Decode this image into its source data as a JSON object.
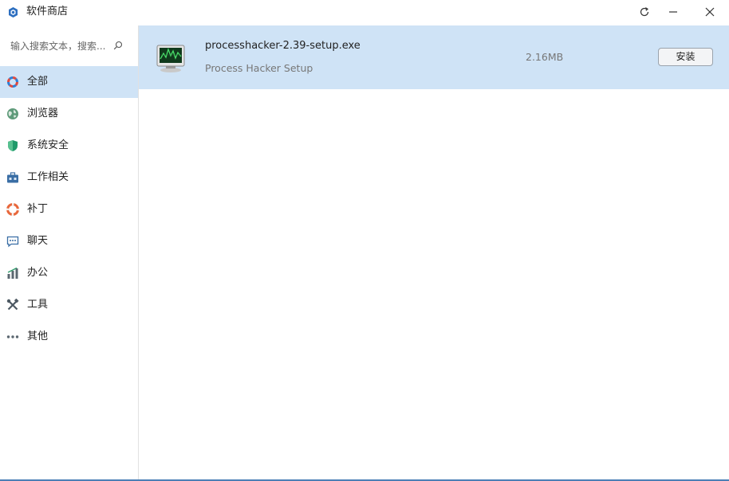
{
  "window": {
    "title": "软件商店"
  },
  "search": {
    "placeholder": "输入搜索文本，搜索..."
  },
  "sidebar": {
    "items": [
      {
        "label": "全部",
        "icon": "all-ring-icon",
        "active": true
      },
      {
        "label": "浏览器",
        "icon": "globe-icon",
        "active": false
      },
      {
        "label": "系统安全",
        "icon": "shield-icon",
        "active": false
      },
      {
        "label": "工作相关",
        "icon": "briefcase-icon",
        "active": false
      },
      {
        "label": "补丁",
        "icon": "lifebuoy-icon",
        "active": false
      },
      {
        "label": "聊天",
        "icon": "chat-bubble-icon",
        "active": false
      },
      {
        "label": "办公",
        "icon": "bar-chart-icon",
        "active": false
      },
      {
        "label": "工具",
        "icon": "tools-icon",
        "active": false
      },
      {
        "label": "其他",
        "icon": "more-dots-icon",
        "active": false
      }
    ]
  },
  "apps": [
    {
      "name": "processhacker-2.39-setup.exe",
      "description": "Process Hacker Setup",
      "size": "2.16MB",
      "install_label": "安装",
      "icon": "monitor-app-icon"
    }
  ],
  "colors": {
    "selected_bg": "#cfe3f6",
    "accent": "#2b6cb0"
  }
}
